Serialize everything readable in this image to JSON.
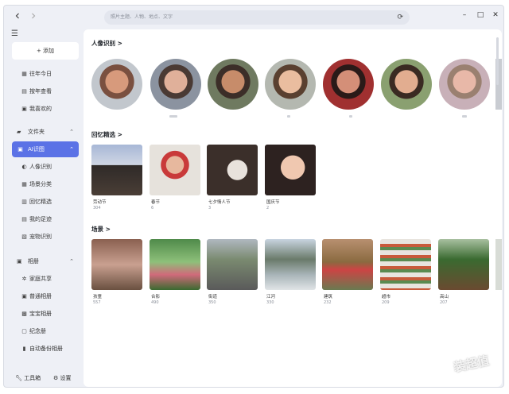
{
  "titlebar": {
    "back_icon": "chevron-left-icon",
    "forward_icon": "chevron-right-icon",
    "search_placeholder": "照片主题、人物、地点、文字",
    "rotate_icon": "refresh-icon",
    "minimize": "–",
    "maximize": "□",
    "close": "✕"
  },
  "sidebar": {
    "add_label": "+ 添加",
    "items": [
      {
        "label": "往年今日",
        "icon": "calendar-icon"
      },
      {
        "label": "按年查看",
        "icon": "calendar-year-icon"
      },
      {
        "label": "我喜欢的",
        "icon": "heart-icon"
      }
    ],
    "folder_head": "文件夹",
    "ai_label": "AI识图",
    "ai_items": [
      {
        "label": "人像识别",
        "icon": "person-icon"
      },
      {
        "label": "场景分类",
        "icon": "scene-icon"
      },
      {
        "label": "回忆精选",
        "icon": "memory-icon"
      },
      {
        "label": "我的足迹",
        "icon": "footprint-icon"
      },
      {
        "label": "宠物识别",
        "icon": "pet-icon"
      }
    ],
    "album_head": "相册",
    "album_items": [
      {
        "label": "家庭共享",
        "icon": "share-icon"
      },
      {
        "label": "普通相册",
        "icon": "album-icon"
      },
      {
        "label": "宝宝相册",
        "icon": "baby-icon"
      },
      {
        "label": "纪念册",
        "icon": "memorial-icon"
      },
      {
        "label": "自动备份相册",
        "icon": "backup-icon"
      }
    ],
    "tools_label": "工具箱",
    "settings_label": "设置"
  },
  "main": {
    "people_title": "人像识别 >",
    "memories_title": "回忆精选 >",
    "scenes_title": "场景 >",
    "memories": [
      {
        "name": "劳动节",
        "count": "304"
      },
      {
        "name": "春节",
        "count": "6"
      },
      {
        "name": "七夕情人节",
        "count": "3"
      },
      {
        "name": "国庆节",
        "count": "2"
      }
    ],
    "scenes": [
      {
        "name": "孩童",
        "count": "557"
      },
      {
        "name": "合影",
        "count": "490"
      },
      {
        "name": "街道",
        "count": "350"
      },
      {
        "name": "江河",
        "count": "330"
      },
      {
        "name": "建筑",
        "count": "232"
      },
      {
        "name": "超市",
        "count": "209"
      },
      {
        "name": "高山",
        "count": "207"
      }
    ]
  },
  "watermark": "装超值",
  "colors": {
    "accent": "#5b72e6",
    "sidebar_bg": "#eef0f6",
    "content_bg": "#ffffff"
  }
}
